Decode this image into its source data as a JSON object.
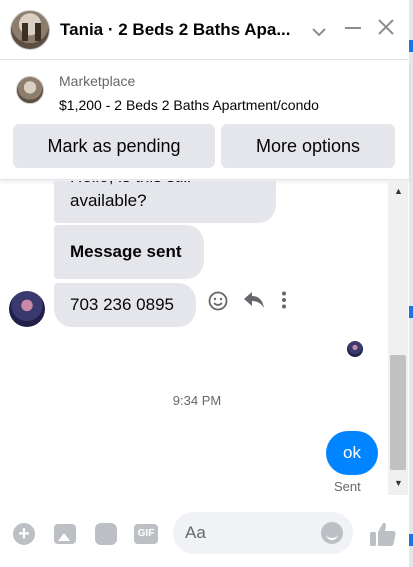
{
  "header": {
    "title": "Tania · 2 Beds 2 Baths Apa...",
    "icons": {
      "dropdown": "chevron-down-icon",
      "minimize": "minus-icon",
      "close": "close-icon"
    }
  },
  "marketplace": {
    "label": "Marketplace",
    "listing": "$1,200 - 2 Beds 2 Baths Apartment/condo",
    "buttons": {
      "pending": "Mark as pending",
      "more": "More options"
    }
  },
  "messages": {
    "partial_text": "Hello, is this still",
    "first_bubble_line2": "available?",
    "second_bubble": "Message sent",
    "third_bubble": "703 236 0895",
    "timestamp": "9:34 PM",
    "my_message": "ok",
    "my_status": "Sent"
  },
  "composer": {
    "placeholder": "Aa"
  },
  "colors": {
    "accent": "#0084ff",
    "bubble_bg": "#e4e6eb",
    "icon_gray": "#bcc0c4"
  }
}
